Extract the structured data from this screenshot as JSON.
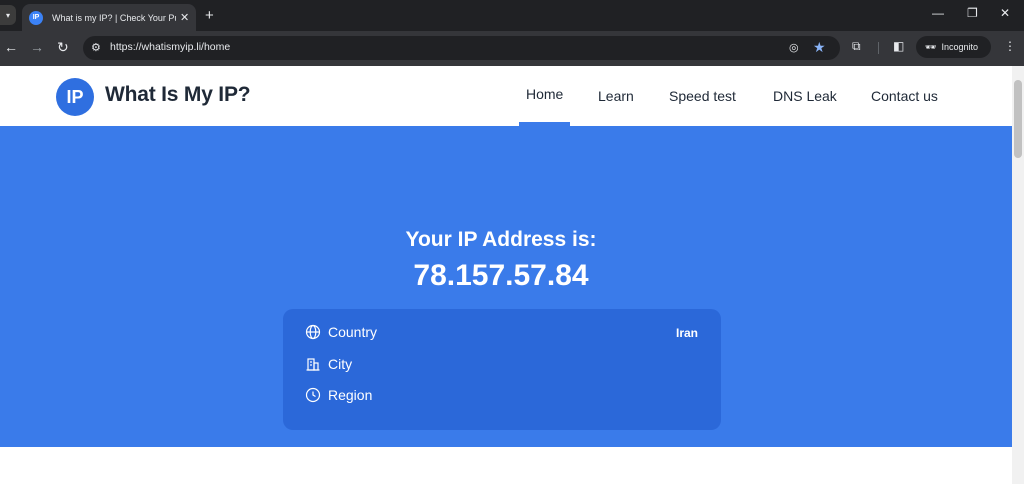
{
  "browser": {
    "tab_title": "What is my IP? | Check Your Pul",
    "favicon_text": "IP",
    "url": "https://whatismyip.li/home",
    "incognito_label": "Incognito"
  },
  "site": {
    "logo_text": "IP",
    "brand": "What Is My IP?",
    "nav": [
      {
        "label": "Home"
      },
      {
        "label": "Learn"
      },
      {
        "label": "Speed test"
      },
      {
        "label": "DNS Leak"
      },
      {
        "label": "Contact us"
      }
    ]
  },
  "hero": {
    "title": "Your IP Address is:",
    "ip": "78.157.57.84"
  },
  "details": {
    "country_label": "Country",
    "country_value": "Iran",
    "city_label": "City",
    "region_label": "Region"
  },
  "icons": {
    "country": "globe-icon",
    "city": "building-icon",
    "region": "clock-icon"
  },
  "colors": {
    "hero": "#3a7bea",
    "card": "#2b68d9",
    "accent": "#3b7bea"
  }
}
